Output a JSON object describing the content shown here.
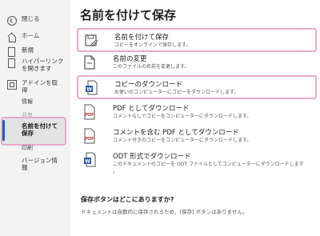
{
  "sidebar": {
    "back_label": "閉じる",
    "home_label": "ホーム",
    "new_label": "新規",
    "hyperlink_line1": "ハイパーリンク",
    "hyperlink_line2": "を開きます",
    "addin_line1": "アドインを取",
    "addin_line2": "得",
    "info_label": "情報",
    "share_label": "共有",
    "saveas_line1": "名前を付けて",
    "saveas_line2": "保存",
    "print_label": "印刷",
    "version_line1": "バージョン情",
    "version_line2": "報",
    "active_color": "#1f5fbf",
    "highlight_color": "#e8a9c9"
  },
  "main": {
    "title": "名前を付けて保存",
    "options": [
      {
        "title": "名前を付けて保存",
        "desc": "コピーをオンラインで保存します。",
        "icon": "save-as-icon"
      },
      {
        "title": "名前の変更",
        "desc": "このファイルの名前を変更します。",
        "icon": "rename-icon"
      },
      {
        "title": "コピーのダウンロード",
        "desc": "お使いのコンピューターにコピーをダウンロードします。",
        "icon": "word-doc-icon"
      },
      {
        "title": "PDF としてダウンロード",
        "desc": "コメントなしでコピーをコンピューターにダウンロードします。",
        "icon": "pdf-icon"
      },
      {
        "title": "コメントを含む PDF としてダウンロード",
        "desc": "コメント付きのコピーをコンピューターにダウンロードします。",
        "icon": "pdf-comments-icon"
      },
      {
        "title": "ODT 形式でダウンロード",
        "desc1": "このドキュメントのコピーを ODT ファイルとしてコンピューターにダウンロードします",
        "desc2": "。",
        "icon": "odt-icon"
      }
    ],
    "question_title": "保存ボタンはどこにありますか?",
    "question_desc": "ドキュメントは自動的に保存されるため、[保存] ボタンはありません。"
  }
}
